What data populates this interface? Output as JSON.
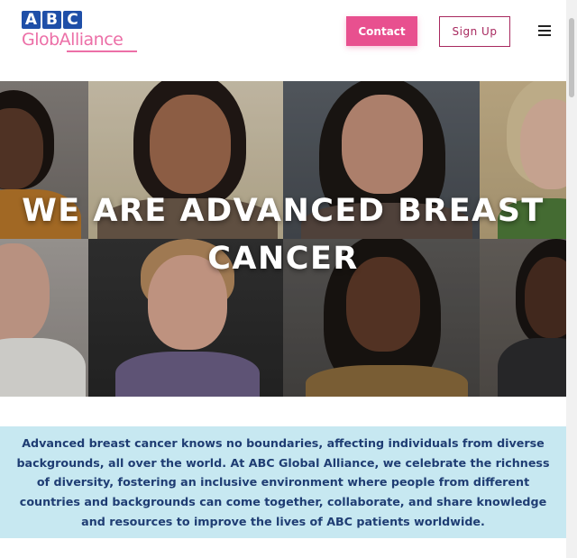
{
  "header": {
    "logo": {
      "abc_letters": [
        "A",
        "B",
        "C"
      ],
      "wordmark": "GlobAlliance"
    },
    "contact_label": "Contact",
    "signup_label": "Sign Up",
    "menu_icon": "hamburger-icon"
  },
  "hero": {
    "title_line1": "WE ARE ADVANCED BREAST",
    "title_line2": "CANCER"
  },
  "intro": {
    "text": "Advanced breast cancer knows no boundaries, affecting individuals from diverse backgrounds, all over the world. At ABC Global Alliance, we celebrate the richness of diversity, fostering an inclusive environment where people from different countries and backgrounds can come together, collaborate, and share knowledge and resources to improve the lives of ABC patients worldwide."
  },
  "colors": {
    "brand_blue": "#1f4fa8",
    "brand_pink": "#e8508f",
    "signup_border": "#a8295f",
    "intro_bg": "#c7e8f1",
    "intro_text": "#1f3d73"
  }
}
